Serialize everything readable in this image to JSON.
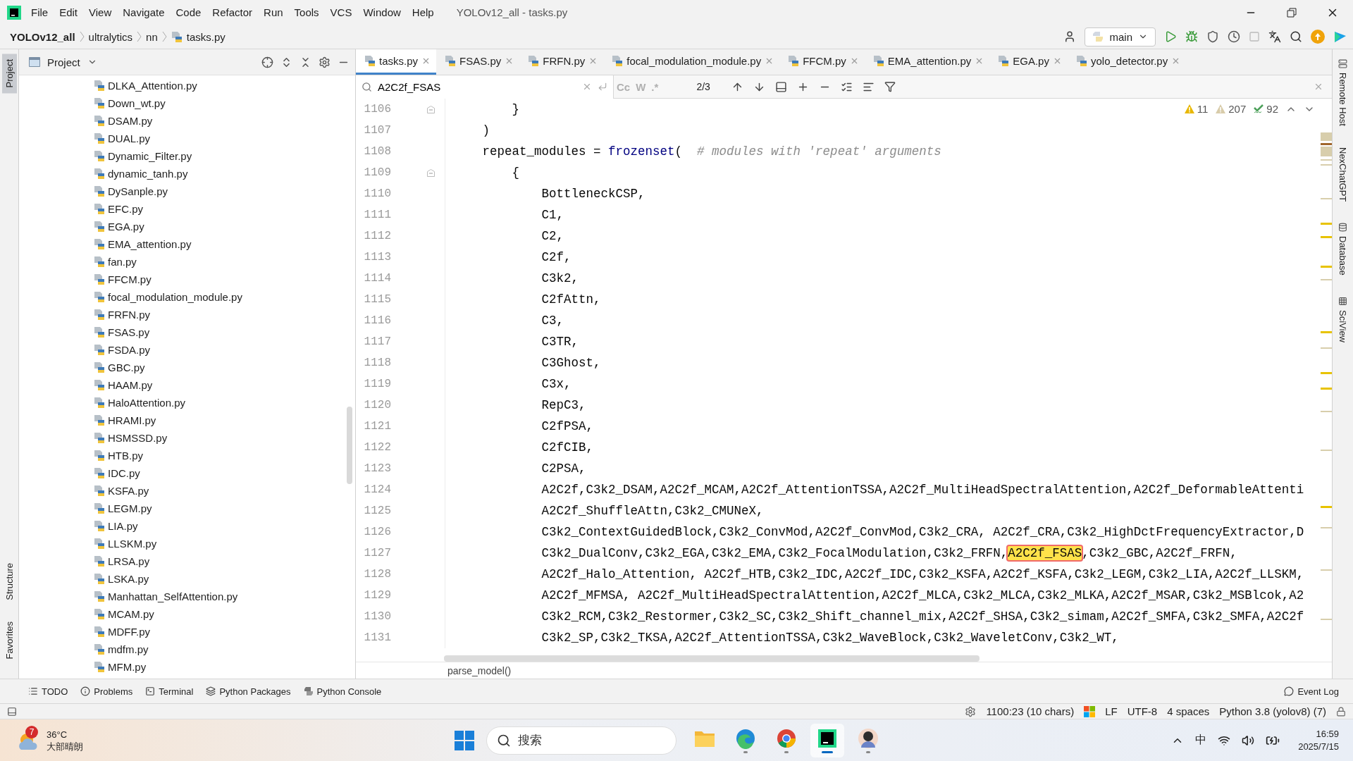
{
  "menu_bar": {
    "items": [
      "File",
      "Edit",
      "View",
      "Navigate",
      "Code",
      "Refactor",
      "Run",
      "Tools",
      "VCS",
      "Window",
      "Help"
    ],
    "window_title": "YOLOv12_all - tasks.py"
  },
  "nav_bar": {
    "breadcrumb": [
      {
        "label": "YOLOv12_all",
        "kind": "project"
      },
      {
        "label": "ultralytics",
        "kind": "folder"
      },
      {
        "label": "nn",
        "kind": "folder"
      },
      {
        "label": "tasks.py",
        "kind": "file"
      }
    ],
    "run_config": "main"
  },
  "left_strip": {
    "top": [
      {
        "label": "Project",
        "selected": true
      }
    ],
    "bottom": [
      {
        "label": "Structure",
        "selected": false
      },
      {
        "label": "Favorites",
        "selected": false
      }
    ]
  },
  "project_panel": {
    "title": "Project",
    "files": [
      "DLKA_Attention.py",
      "Down_wt.py",
      "DSAM.py",
      "DUAL.py",
      "Dynamic_Filter.py",
      "dynamic_tanh.py",
      "DySanple.py",
      "EFC.py",
      "EGA.py",
      "EMA_attention.py",
      "fan.py",
      "FFCM.py",
      "focal_modulation_module.py",
      "FRFN.py",
      "FSAS.py",
      "FSDA.py",
      "GBC.py",
      "HAAM.py",
      "HaloAttention.py",
      "HRAMI.py",
      "HSMSSD.py",
      "HTB.py",
      "IDC.py",
      "KSFA.py",
      "LEGM.py",
      "LIA.py",
      "LLSKM.py",
      "LRSA.py",
      "LSKA.py",
      "Manhattan_SelfAttention.py",
      "MCAM.py",
      "MDFF.py",
      "mdfm.py",
      "MFM.py"
    ]
  },
  "tabs": [
    {
      "label": "tasks.py",
      "selected": true
    },
    {
      "label": "FSAS.py",
      "selected": false
    },
    {
      "label": "FRFN.py",
      "selected": false
    },
    {
      "label": "focal_modulation_module.py",
      "selected": false
    },
    {
      "label": "FFCM.py",
      "selected": false
    },
    {
      "label": "EMA_attention.py",
      "selected": false
    },
    {
      "label": "EGA.py",
      "selected": false
    },
    {
      "label": "yolo_detector.py",
      "selected": false
    }
  ],
  "find_bar": {
    "value": "A2C2f_FSAS",
    "options": [
      {
        "label": "Cc",
        "selected": false
      },
      {
        "label": "W",
        "selected": false
      },
      {
        "label": ".*",
        "selected": false
      }
    ],
    "match_count": "2/3"
  },
  "inspections": [
    {
      "kind": "warning",
      "count": "11"
    },
    {
      "kind": "weak_warning",
      "count": "207"
    },
    {
      "kind": "typo",
      "count": "92"
    }
  ],
  "code_lines": [
    {
      "number": "1106",
      "fold": true,
      "text": "        }"
    },
    {
      "number": "1107",
      "fold": false,
      "text": "    )"
    },
    {
      "number": "1108",
      "fold": false,
      "tokens": [
        {
          "kind": "plain",
          "text": "    repeat_modules = "
        },
        {
          "kind": "builtin",
          "text": "frozenset"
        },
        {
          "kind": "plain",
          "text": "(  "
        },
        {
          "kind": "comment",
          "text": "# modules with 'repeat' arguments"
        }
      ]
    },
    {
      "number": "1109",
      "fold": true,
      "text": "        {"
    },
    {
      "number": "1110",
      "fold": false,
      "text": "            BottleneckCSP,"
    },
    {
      "number": "1111",
      "fold": false,
      "text": "            C1,"
    },
    {
      "number": "1112",
      "fold": false,
      "text": "            C2,"
    },
    {
      "number": "1113",
      "fold": false,
      "text": "            C2f,"
    },
    {
      "number": "1114",
      "fold": false,
      "text": "            C3k2,"
    },
    {
      "number": "1115",
      "fold": false,
      "text": "            C2fAttn,"
    },
    {
      "number": "1116",
      "fold": false,
      "text": "            C3,"
    },
    {
      "number": "1117",
      "fold": false,
      "text": "            C3TR,"
    },
    {
      "number": "1118",
      "fold": false,
      "text": "            C3Ghost,"
    },
    {
      "number": "1119",
      "fold": false,
      "text": "            C3x,"
    },
    {
      "number": "1120",
      "fold": false,
      "text": "            RepC3,"
    },
    {
      "number": "1121",
      "fold": false,
      "text": "            C2fPSA,"
    },
    {
      "number": "1122",
      "fold": false,
      "text": "            C2fCIB,"
    },
    {
      "number": "1123",
      "fold": false,
      "text": "            C2PSA,"
    },
    {
      "number": "1124",
      "fold": false,
      "text": "            A2C2f,C3k2_DSAM,A2C2f_MCAM,A2C2f_AttentionTSSA,A2C2f_MultiHeadSpectralAttention,A2C2f_DeformableAttenti"
    },
    {
      "number": "1125",
      "fold": false,
      "text": "            A2C2f_ShuffleAttn,C3k2_CMUNeX,"
    },
    {
      "number": "1126",
      "fold": false,
      "text": "            C3k2_ContextGuidedBlock,C3k2_ConvMod,A2C2f_ConvMod,C3k2_CRA, A2C2f_CRA,C3k2_HighDctFrequencyExtractor,D"
    },
    {
      "number": "1127",
      "fold": false,
      "tokens": [
        {
          "kind": "plain",
          "text": "            C3k2_DualConv,C3k2_EGA,C3k2_EMA,C3k2_FocalModulation,C3k2_FRFN,"
        },
        {
          "kind": "match",
          "text": "A2C2f_FSAS"
        },
        {
          "kind": "plain",
          "text": ",C3k2_GBC,A2C2f_FRFN,"
        }
      ]
    },
    {
      "number": "1128",
      "fold": false,
      "text": "            A2C2f_Halo_Attention, A2C2f_HTB,C3k2_IDC,A2C2f_IDC,C3k2_KSFA,A2C2f_KSFA,C3k2_LEGM,C3k2_LIA,A2C2f_LLSKM,"
    },
    {
      "number": "1129",
      "fold": false,
      "text": "            A2C2f_MFMSA, A2C2f_MultiHeadSpectralAttention,A2C2f_MLCA,C3k2_MLCA,C3k2_MLKA,A2C2f_MSAR,C3k2_MSBlcok,A2"
    },
    {
      "number": "1130",
      "fold": false,
      "text": "            C3k2_RCM,C3k2_Restormer,C3k2_SC,C3k2_Shift_channel_mix,A2C2f_SHSA,C3k2_simam,A2C2f_SMFA,C3k2_SMFA,A2C2f"
    },
    {
      "number": "1131",
      "fold": false,
      "text": "            C3k2_SP,C3k2_TKSA,A2C2f_AttentionTSSA,C3k2_WaveBlock,C3k2_WaveletConv,C3k2_WT,"
    }
  ],
  "editor_breadcrumb": "parse_model()",
  "right_strip": [
    {
      "label": "Remote Host",
      "kind": "server"
    },
    {
      "label": "NexChatGPT",
      "kind": "plain"
    },
    {
      "label": "Database",
      "kind": "database"
    },
    {
      "label": "SciView",
      "kind": "grid"
    }
  ],
  "tool_windows": [
    {
      "label": "TODO",
      "kind": "list"
    },
    {
      "label": "Problems",
      "kind": "info"
    },
    {
      "label": "Terminal",
      "kind": "terminal"
    },
    {
      "label": "Python Packages",
      "kind": "layers"
    },
    {
      "label": "Python Console",
      "kind": "python"
    }
  ],
  "event_log": "Event Log",
  "status_bar": {
    "position": "1100:23 (10 chars)",
    "line_separator": "LF",
    "encoding": "UTF-8",
    "indent": "4 spaces",
    "interpreter": "Python 3.8 (yolov8) (7)"
  },
  "taskbar": {
    "weather": {
      "temperature": "36°C",
      "description": "大部晴朗",
      "badge": "7"
    },
    "search_placeholder": "搜索",
    "apps": [
      {
        "kind": "folder",
        "running": false,
        "selected": false
      },
      {
        "kind": "edge",
        "running": true,
        "selected": false
      },
      {
        "kind": "chrome",
        "running": true,
        "selected": false
      },
      {
        "kind": "pycharm",
        "running": true,
        "selected": true
      },
      {
        "kind": "avatar",
        "running": true,
        "selected": false
      }
    ],
    "input_method": "中",
    "time": "16:59",
    "date": "2025/7/15"
  }
}
